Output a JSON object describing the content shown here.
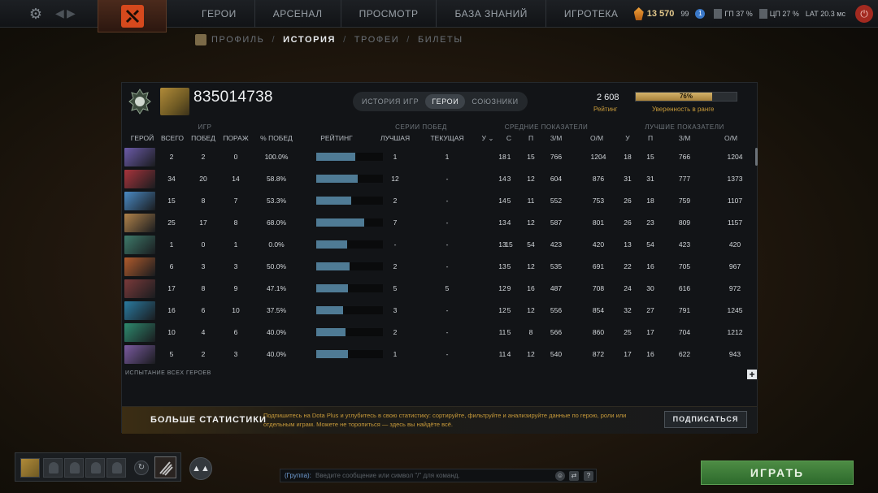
{
  "topbar": {
    "nav": [
      "ГЕРОИ",
      "АРСЕНАЛ",
      "ПРОСМОТР",
      "БАЗА ЗНАНИЙ",
      "ИГРОТЕКА"
    ],
    "shards": "13 570",
    "level": "99",
    "badge": "1",
    "cpu_label": "ГП",
    "cpu_val": "37 %",
    "gpu_label": "ЦП",
    "gpu_val": "27 %",
    "lat_label": "LAT",
    "lat_val": "20.3 мс"
  },
  "subnav": [
    "ПРОФИЛЬ",
    "ИСТОРИЯ",
    "ТРОФЕИ",
    "БИЛЕТЫ"
  ],
  "profile": {
    "player_id": "835014738",
    "tabs": [
      "ИСТОРИЯ ИГР",
      "ГЕРОИ",
      "СОЮЗНИКИ"
    ],
    "rating_value": "2 608",
    "rating_label": "Рейтинг",
    "confidence": 0.76,
    "confidence_text": "76%",
    "confidence_label": "Уверенность в ранге"
  },
  "table": {
    "groups": {
      "games": "ИГР",
      "streaks": "СЕРИИ ПОБЕД",
      "avg": "СРЕДНИЕ ПОКАЗАТЕЛИ",
      "best": "ЛУЧШИЕ ПОКАЗАТЕЛИ"
    },
    "headers": {
      "hero": "ГЕРОЙ",
      "total": "ВСЕГО",
      "wins": "ПОБЕД",
      "losses": "ПОРАЖ",
      "winrate": "% ПОБЕД",
      "rating": "РЕЙТИНГ",
      "best_streak": "ЛУЧШАЯ",
      "current_streak": "ТЕКУЩАЯ",
      "avg_k": "У",
      "avg_d": "С",
      "avg_a": "П",
      "avg_lh": "З/М",
      "avg_xpm": "О/М",
      "best_k": "У",
      "best_a": "П",
      "best_lh": "З/М",
      "best_xpm": "О/М"
    },
    "rows": [
      {
        "color": "#6b5aa8",
        "total": "2",
        "wins": "2",
        "losses": "0",
        "wr": "100.0%",
        "bar": 0.58,
        "best": "1",
        "cur": "1",
        "k": "18",
        "d": "1",
        "a": "15",
        "lh": "766",
        "xpm": "1204",
        "bk": "18",
        "ba": "15",
        "blh": "766",
        "bxpm": "1204"
      },
      {
        "color": "#a8343c",
        "total": "34",
        "wins": "20",
        "losses": "14",
        "wr": "58.8%",
        "bar": 0.62,
        "best": "12",
        "cur": "-",
        "k": "14",
        "d": "3",
        "a": "12",
        "lh": "604",
        "xpm": "876",
        "bk": "31",
        "ba": "31",
        "blh": "777",
        "bxpm": "1373"
      },
      {
        "color": "#4a8ac4",
        "total": "15",
        "wins": "8",
        "losses": "7",
        "wr": "53.3%",
        "bar": 0.53,
        "best": "2",
        "cur": "-",
        "k": "14",
        "d": "5",
        "a": "11",
        "lh": "552",
        "xpm": "753",
        "bk": "26",
        "ba": "18",
        "blh": "759",
        "bxpm": "1107"
      },
      {
        "color": "#b0824a",
        "total": "25",
        "wins": "17",
        "losses": "8",
        "wr": "68.0%",
        "bar": 0.72,
        "best": "7",
        "cur": "-",
        "k": "13",
        "d": "4",
        "a": "12",
        "lh": "587",
        "xpm": "801",
        "bk": "26",
        "ba": "23",
        "blh": "809",
        "bxpm": "1157"
      },
      {
        "color": "#3e7a6a",
        "total": "1",
        "wins": "0",
        "losses": "1",
        "wr": "0.0%",
        "bar": 0.46,
        "best": "-",
        "cur": "-",
        "k": "13",
        "d": "15",
        "a": "54",
        "lh": "423",
        "xpm": "420",
        "bk": "13",
        "ba": "54",
        "blh": "423",
        "bxpm": "420"
      },
      {
        "color": "#b05a2c",
        "total": "6",
        "wins": "3",
        "losses": "3",
        "wr": "50.0%",
        "bar": 0.5,
        "best": "2",
        "cur": "-",
        "k": "13",
        "d": "5",
        "a": "12",
        "lh": "535",
        "xpm": "691",
        "bk": "22",
        "ba": "16",
        "blh": "705",
        "bxpm": "967"
      },
      {
        "color": "#7a3a3a",
        "total": "17",
        "wins": "8",
        "losses": "9",
        "wr": "47.1%",
        "bar": 0.48,
        "best": "5",
        "cur": "5",
        "k": "12",
        "d": "9",
        "a": "16",
        "lh": "487",
        "xpm": "708",
        "bk": "24",
        "ba": "30",
        "blh": "616",
        "bxpm": "972"
      },
      {
        "color": "#2a7aa0",
        "total": "16",
        "wins": "6",
        "losses": "10",
        "wr": "37.5%",
        "bar": 0.4,
        "best": "3",
        "cur": "-",
        "k": "12",
        "d": "5",
        "a": "12",
        "lh": "556",
        "xpm": "854",
        "bk": "32",
        "ba": "27",
        "blh": "791",
        "bxpm": "1245"
      },
      {
        "color": "#2e8a6e",
        "total": "10",
        "wins": "4",
        "losses": "6",
        "wr": "40.0%",
        "bar": 0.44,
        "best": "2",
        "cur": "-",
        "k": "11",
        "d": "5",
        "a": "8",
        "lh": "566",
        "xpm": "860",
        "bk": "25",
        "ba": "17",
        "blh": "704",
        "bxpm": "1212"
      },
      {
        "color": "#7a5aa0",
        "total": "5",
        "wins": "2",
        "losses": "3",
        "wr": "40.0%",
        "bar": 0.48,
        "best": "1",
        "cur": "-",
        "k": "11",
        "d": "4",
        "a": "12",
        "lh": "540",
        "xpm": "872",
        "bk": "17",
        "ba": "16",
        "blh": "622",
        "bxpm": "943"
      }
    ],
    "all_heroes": "ИСПЫТАНИЕ ВСЕХ ГЕРОЕВ"
  },
  "promo": {
    "title": "БОЛЬШЕ СТАТИСТИКИ",
    "text": "Подпишитесь на Dota Plus и углубитесь в свою статистику: сортируйте, фильтруйте и анализируйте данные по герою, роли или отдельным играм. Можете не торопиться — здесь вы найдёте всё.",
    "button": "ПОДПИСАТЬСЯ"
  },
  "chat": {
    "group": "(Группа):",
    "placeholder": "Введите сообщение или символ \"/\" для команд."
  },
  "play_button": "ИГРАТЬ"
}
